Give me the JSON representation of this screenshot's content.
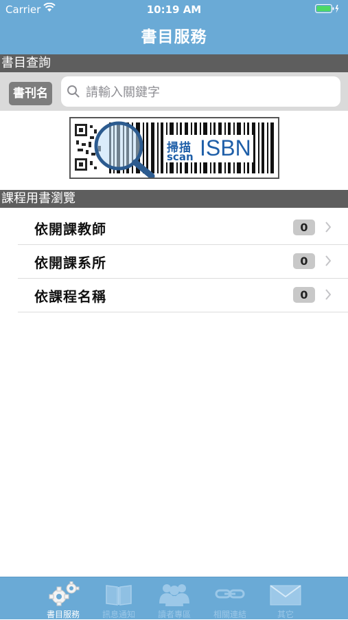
{
  "status_bar": {
    "carrier": "Carrier",
    "time": "10:19 AM"
  },
  "nav": {
    "title": "書目服務"
  },
  "search_section": {
    "header": "書目查詢",
    "scope_button": "書刊名",
    "placeholder": "請輸入關鍵字",
    "scan_button": {
      "label_cn": "掃描",
      "label_en": "scan",
      "label_isbn": "ISBN"
    }
  },
  "course_section": {
    "header": "課程用書瀏覽",
    "items": [
      {
        "label": "依開課教師",
        "count": "0"
      },
      {
        "label": "依開課系所",
        "count": "0"
      },
      {
        "label": "依課程名稱",
        "count": "0"
      }
    ]
  },
  "tabbar": {
    "tabs": [
      {
        "label": "書目服務",
        "icon": "gears-icon",
        "active": true
      },
      {
        "label": "訊息通知",
        "icon": "book-icon",
        "active": false
      },
      {
        "label": "讀者專區",
        "icon": "people-icon",
        "active": false
      },
      {
        "label": "相關連結",
        "icon": "link-icon",
        "active": false
      },
      {
        "label": "其它",
        "icon": "mail-icon",
        "active": false
      }
    ]
  },
  "colors": {
    "header_blue": "#6aaad6",
    "section_gray": "#5e5e5e",
    "isbn_blue": "#1f5fa8"
  }
}
